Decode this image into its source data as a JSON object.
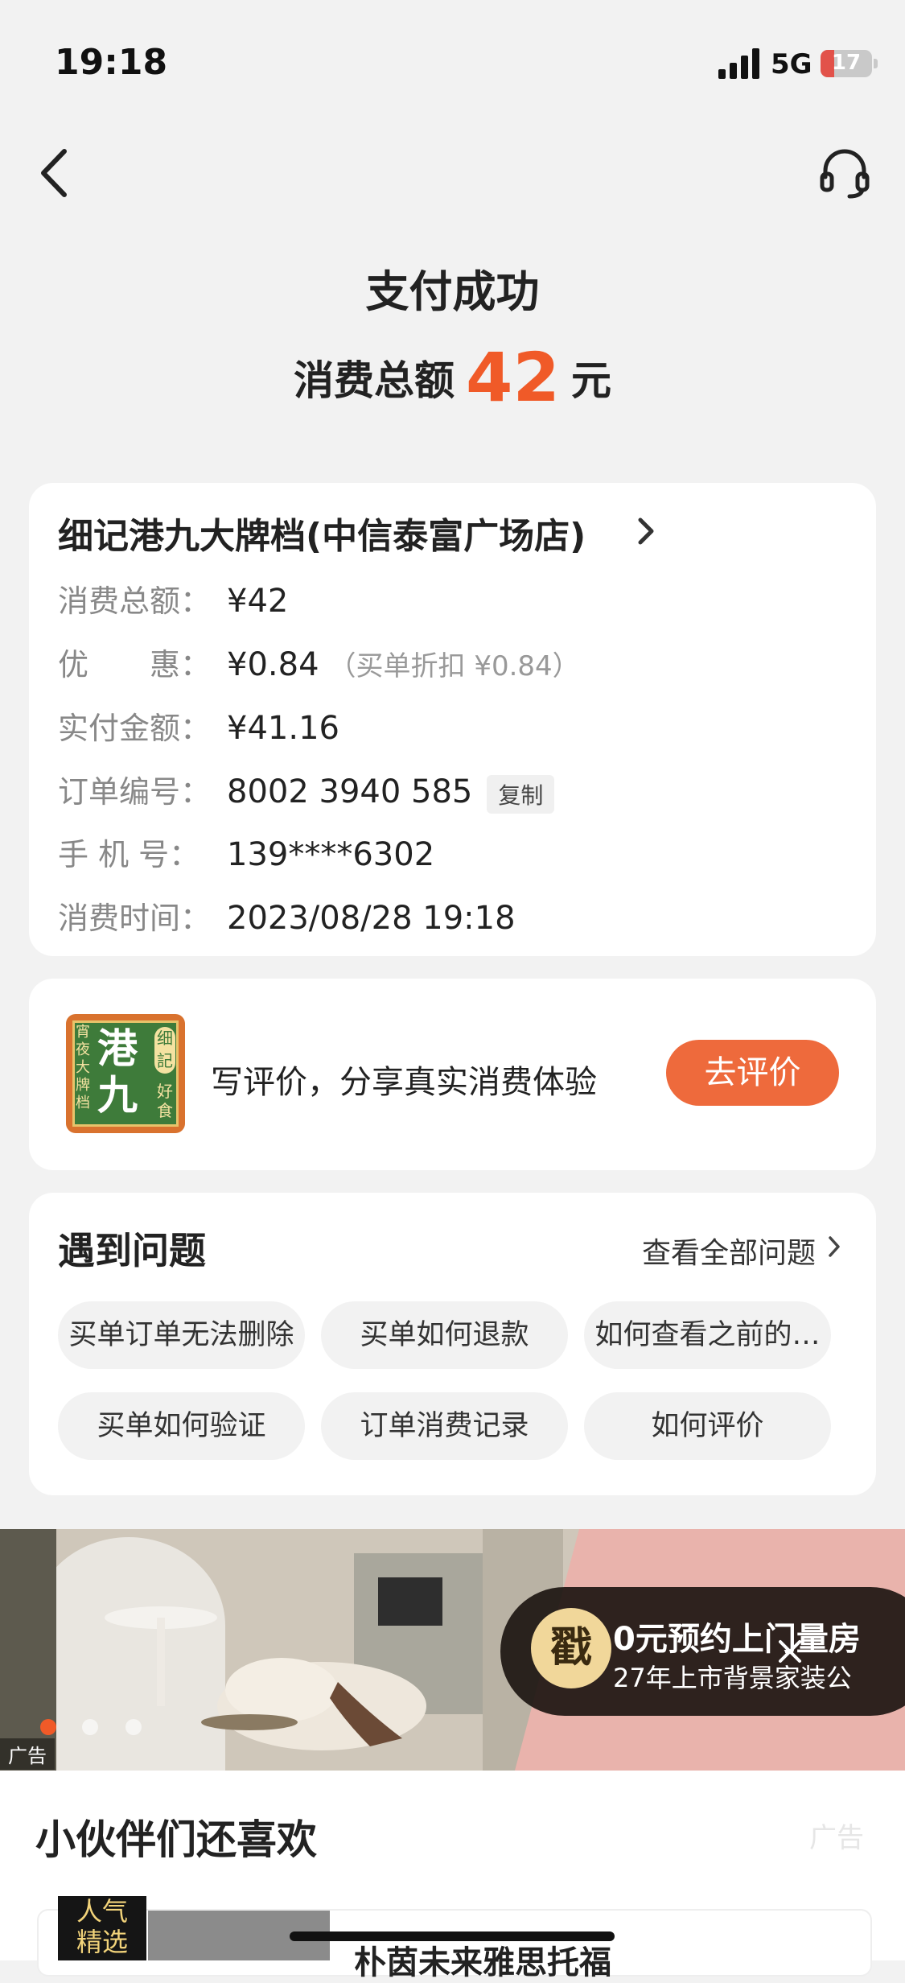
{
  "status": {
    "time": "19:18",
    "network": "5G",
    "battery": "17",
    "battery_level": 0.17
  },
  "nav": {
    "back_icon": "chevron-left-icon",
    "service_icon": "headset-icon"
  },
  "header": {
    "title": "支付成功",
    "amount_label": "消费总额",
    "amount_value": "42",
    "amount_unit": "元",
    "accent": "#f05a28"
  },
  "order": {
    "shop_name": "细记港九大牌档(中信泰富广场店)",
    "rows": [
      {
        "label": "消费总额：",
        "value": "¥42"
      },
      {
        "label": "优　　惠：",
        "value": "¥0.84",
        "note": "（买单折扣 ¥0.84）"
      },
      {
        "label": "实付金额：",
        "value": "¥41.16"
      },
      {
        "label": "订单编号：",
        "value": "8002 3940 585",
        "action": "复制"
      },
      {
        "label": "手  机  号：",
        "value": "139****6302"
      },
      {
        "label": "消费时间：",
        "value": "2023/08/28 19:18"
      }
    ]
  },
  "review": {
    "logo": {
      "main": "港九",
      "left": "宵夜大牌档",
      "right_top": "细記",
      "right_bottom": "好食"
    },
    "text": "写评价，分享真实消费体验",
    "button": "去评价",
    "button_color": "#ee6a3c"
  },
  "questions": {
    "title": "遇到问题",
    "view_all": "查看全部问题",
    "items": [
      "买单订单无法删除",
      "买单如何退款",
      "如何查看之前的…",
      "买单如何验证",
      "订单消费记录",
      "如何评价"
    ]
  },
  "ad": {
    "tag": "广告",
    "icon_char": "戳",
    "line1": "0元预约上门量房",
    "line2": "27年上市背景家装公",
    "active_dot": 0,
    "dots": 3
  },
  "recommend": {
    "title": "小伙伴们还喜欢",
    "ad_tag": "广告",
    "badge_line1": "人气",
    "badge_line2": "精选",
    "item_name": "朴茵未来雅思托福"
  }
}
